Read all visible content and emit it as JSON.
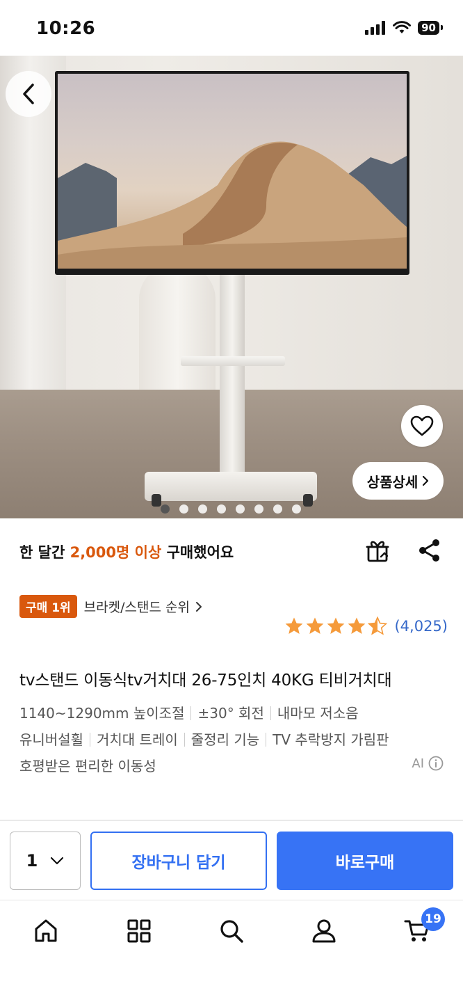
{
  "status_bar": {
    "time": "10:26",
    "battery": "90"
  },
  "product_image": {
    "detail_button_label": "상품상세",
    "page_count": 8,
    "active_page": 0
  },
  "sales": {
    "prefix": "한 달간",
    "highlight": "2,000명 이상",
    "suffix": "구매했어요",
    "highlight_color": "#d9580d"
  },
  "ranking": {
    "badge": "구매 1위",
    "category_label": "브라켓/스탠드 순위"
  },
  "rating": {
    "stars": 4.5,
    "count_label": "(4,025)"
  },
  "product": {
    "title": "tv스탠드 이동식tv거치대 26-75인치 40KG 티비거치대",
    "features": [
      [
        "1140~1290mm 높이조절",
        "±30° 회전",
        "내마모 저소음"
      ],
      [
        "유니버설휠",
        "거치대 트레이",
        "줄정리 기능",
        "TV 추락방지 가림판"
      ],
      [
        "호평받은 편리한 이동성"
      ]
    ],
    "ai_label": "AI"
  },
  "purchase_bar": {
    "quantity": "1",
    "cart_label": "장바구니 담기",
    "buy_label": "바로구매",
    "accent_color": "#3773f5"
  },
  "tab_bar": {
    "items": [
      "home-icon",
      "category-icon",
      "search-icon",
      "my-page-icon",
      "cart-icon"
    ],
    "cart_count": "19"
  }
}
